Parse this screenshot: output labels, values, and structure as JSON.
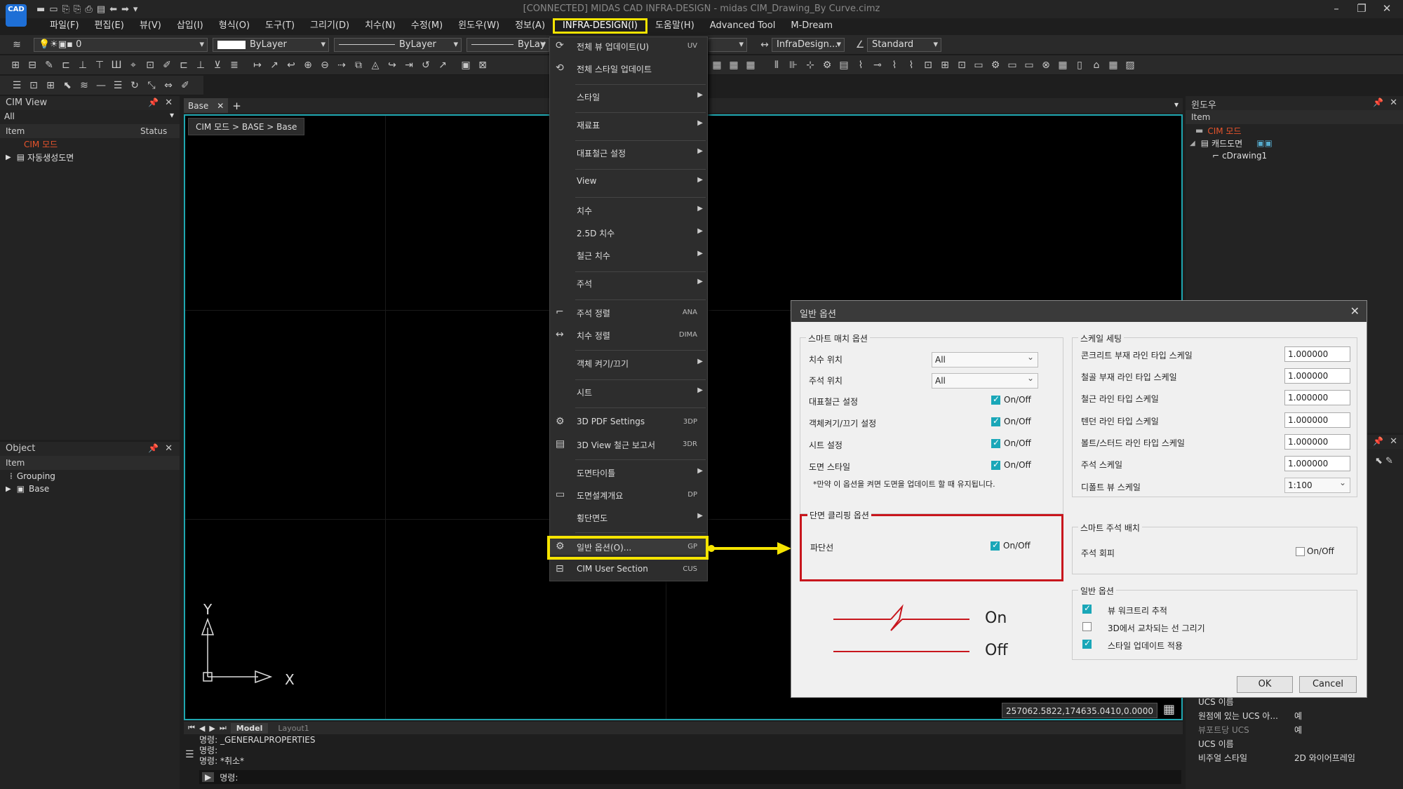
{
  "app": {
    "logo_text": "CAD",
    "title": "[CONNECTED] MIDAS CAD INFRA-DESIGN - midas CIM_Drawing_By Curve.cimz"
  },
  "menubar": [
    "파일(F)",
    "편집(E)",
    "뷰(V)",
    "삽입(I)",
    "형식(O)",
    "도구(T)",
    "그리기(D)",
    "치수(N)",
    "수정(M)",
    "윈도우(W)",
    "정보(A)",
    "INFRA-DESIGN(I)",
    "도움말(H)",
    "Advanced Tool",
    "M-Dream"
  ],
  "toolbar": {
    "layer": "0",
    "color": "ByLayer",
    "linetype": "ByLayer",
    "lineweight": "ByLay",
    "dimstyle": "InfraDesign...",
    "style": "Standard"
  },
  "cim_view": {
    "title": "CIM View",
    "filter": "All",
    "col_item": "Item",
    "col_status": "Status",
    "root": "CIM 모드",
    "child": "자동생성도면"
  },
  "object_panel": {
    "title": "Object",
    "col_item": "Item",
    "rows": [
      "Grouping",
      "Base"
    ]
  },
  "window_panel": {
    "title": "윈도우",
    "col_item": "Item",
    "root": "CIM 모드",
    "child": "캐드도면",
    "grandchild": "cDrawing1"
  },
  "doc_tab": "Base",
  "breadcrumb": "CIM 모드 > BASE > Base",
  "dropdown": {
    "items": [
      {
        "label": "전체 뷰 업데이트(U)",
        "sc": "UV"
      },
      {
        "label": "전체 스타일 업데이트",
        "sc": ""
      },
      {
        "label": "스타일",
        "sc": ""
      },
      {
        "label": "재료표",
        "sc": ""
      },
      {
        "label": "대표철근 설정",
        "sc": ""
      },
      {
        "label": "View",
        "sc": ""
      },
      {
        "label": "치수",
        "sc": ""
      },
      {
        "label": "2.5D 치수",
        "sc": ""
      },
      {
        "label": "철근 치수",
        "sc": ""
      },
      {
        "label": "주석",
        "sc": ""
      },
      {
        "label": "주석 정렬",
        "sc": "ANA"
      },
      {
        "label": "치수 정렬",
        "sc": "DIMA"
      },
      {
        "label": "객체 켜기/끄기",
        "sc": ""
      },
      {
        "label": "시트",
        "sc": ""
      },
      {
        "label": "3D PDF Settings",
        "sc": "3DP"
      },
      {
        "label": "3D View 철근 보고서",
        "sc": "3DR"
      },
      {
        "label": "도면타이틀",
        "sc": ""
      },
      {
        "label": "도면설계개요",
        "sc": "DP"
      },
      {
        "label": "횡단면도",
        "sc": ""
      },
      {
        "label": "일반 옵션(O)...",
        "sc": "GP"
      },
      {
        "label": "CIM User Section",
        "sc": "CUS"
      }
    ]
  },
  "dialog": {
    "title": "일반 옵션",
    "smart_match": {
      "title": "스마트 매치 옵션",
      "dim_pos_label": "치수 위치",
      "dim_pos_value": "All",
      "note_pos_label": "주석 위치",
      "note_pos_value": "All",
      "rows": [
        "대표철근 설정",
        "객체켜기/끄기 설정",
        "시트 설정",
        "도면 스타일"
      ],
      "onoff": "On/Off",
      "note": "*만약 이 옵션을 켜면 도면을 업데이트 할 때 유지됩니다."
    },
    "clipping": {
      "title": "단면 클리핑 옵션",
      "row": "파단선",
      "onoff": "On/Off"
    },
    "legend": {
      "on": "On",
      "off": "Off"
    },
    "scale": {
      "title": "스케일 세팅",
      "rows": [
        {
          "label": "콘크리트 부재 라인 타입 스케일",
          "value": "1.000000"
        },
        {
          "label": "철골 부재 라인 타입 스케일",
          "value": "1.000000"
        },
        {
          "label": "철근 라인 타입 스케일",
          "value": "1.000000"
        },
        {
          "label": "텐던 라인 타입 스케일",
          "value": "1.000000"
        },
        {
          "label": "볼트/스터드 라인 타입 스케일",
          "value": "1.000000"
        },
        {
          "label": "주석 스케일",
          "value": "1.000000"
        }
      ],
      "default_view_label": "디폴트 뷰 스케일",
      "default_view_value": "1:100"
    },
    "smart_note": {
      "title": "스마트 주석 배치",
      "row": "주석 회피",
      "onoff": "On/Off"
    },
    "general": {
      "title": "일반 옵션",
      "rows": [
        "뷰 워크트리 추적",
        "3D에서 교차되는 선 그리기",
        "스타일 업데이트 적용"
      ]
    },
    "ok": "OK",
    "cancel": "Cancel"
  },
  "layout_tabs": [
    "Model",
    "Layout1"
  ],
  "coords": "257062.5822,174635.0410,0.0000",
  "command": {
    "lines": [
      "명령: _GENERALPROPERTIES",
      "명령:",
      "명령: *취소*"
    ],
    "prompt": "명령:"
  },
  "props": {
    "rows": [
      {
        "label": "UCS 이름",
        "value": ""
      },
      {
        "label": "원점에 있는 UCS 아...",
        "value": "예"
      },
      {
        "label": "뷰포트당 UCS",
        "value": "예"
      },
      {
        "label": "UCS 이름",
        "value": ""
      },
      {
        "label": "비주얼 스타일",
        "value": "2D 와이어프레임"
      }
    ]
  },
  "axis": {
    "x": "X",
    "y": "Y"
  }
}
